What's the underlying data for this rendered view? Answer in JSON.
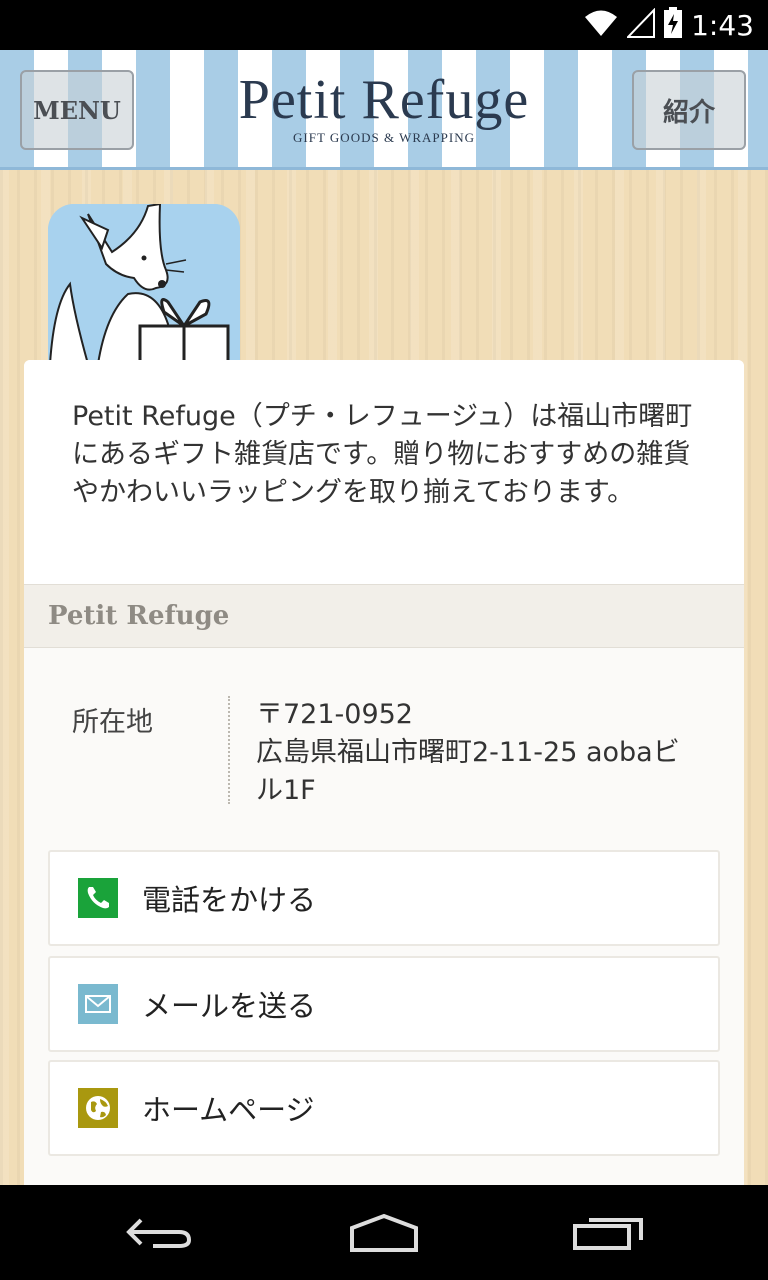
{
  "status_bar": {
    "time": "1:43",
    "icons": [
      "wifi-icon",
      "signal-icon",
      "battery-icon"
    ]
  },
  "header": {
    "menu_label": "MENU",
    "logo_main": "Petit Refuge",
    "logo_sub": "GIFT GOODS & WRAPPING",
    "intro_label": "紹介"
  },
  "shop": {
    "description": "Petit Refuge（プチ・レフュージュ）は福山市曙町にあるギフト雑貨店です。贈り物におすすめの雑貨やかわいいラッピングを取り揃えております。",
    "section_title": "Petit Refuge",
    "address_label": "所在地",
    "postal_code": "〒721-0952",
    "address": "広島県福山市曙町2-11-25 aobaビル1F"
  },
  "actions": [
    {
      "label": "電話をかける",
      "icon": "phone-icon",
      "color": "#1aa33a"
    },
    {
      "label": "メールを送る",
      "icon": "mail-icon",
      "color": "#7ab9cf"
    },
    {
      "label": "ホームページ",
      "icon": "globe-icon",
      "color": "#a9980f"
    }
  ],
  "nav": [
    "back-icon",
    "home-icon",
    "recent-apps-icon"
  ],
  "colors": {
    "header_stripe": "#a9cde6",
    "wood": "#f1ddb7",
    "text": "#333333"
  }
}
